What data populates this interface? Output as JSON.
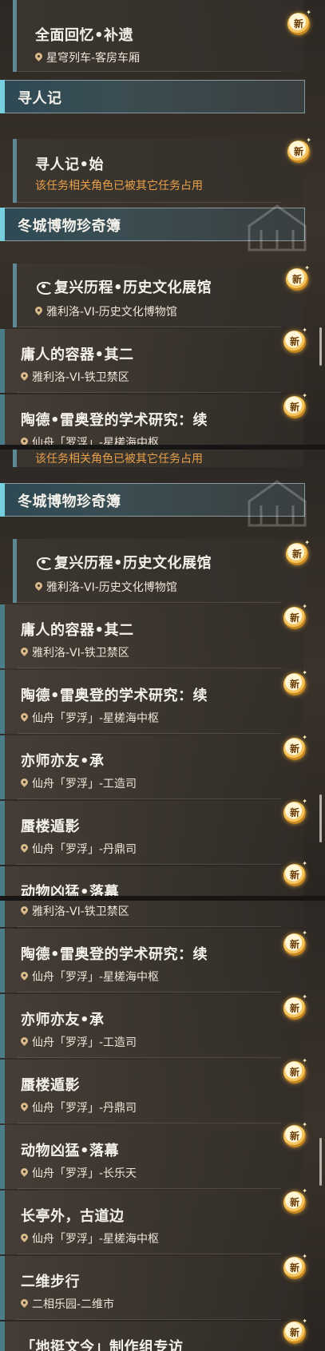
{
  "new_badge": "新",
  "colors": {
    "accent": "#4a7d88",
    "header_bar": "#77d0e0",
    "warn": "#e8a04a",
    "badge": "#f6c45c"
  },
  "panel1": {
    "r1": {
      "title": "全面回忆•补遗",
      "loc": "星穹列车-客房车厢"
    },
    "h1": {
      "title": "寻人记"
    },
    "r2": {
      "title": "寻人记•始",
      "loc": "该任务相关角色已被其它任务占用"
    },
    "h2": {
      "title": "冬城博物珍奇簿"
    },
    "r3": {
      "title": "复兴历程•历史文化展馆",
      "loc": "雅利洛-VI-历史文化博物馆"
    },
    "r4": {
      "title": "庸人的容器•其二",
      "loc": "雅利洛-VI-铁卫禁区"
    },
    "r5": {
      "title": "陶德•雷奥登的学术研究：续",
      "loc": "仙舟「罗浮」-星槎海中枢"
    }
  },
  "panel2": {
    "r0": {
      "loc": "该任务相关角色已被其它任务占用"
    },
    "h1": {
      "title": "冬城博物珍奇簿"
    },
    "r1": {
      "title": "复兴历程•历史文化展馆",
      "loc": "雅利洛-VI-历史文化博物馆"
    },
    "r2": {
      "title": "庸人的容器•其二",
      "loc": "雅利洛-VI-铁卫禁区"
    },
    "r3": {
      "title": "陶德•雷奥登的学术研究：续",
      "loc": "仙舟「罗浮」-星槎海中枢"
    },
    "r4": {
      "title": "亦师亦友•承",
      "loc": "仙舟「罗浮」-工造司"
    },
    "r5": {
      "title": "蜃楼遁影",
      "loc": "仙舟「罗浮」-丹鼎司"
    },
    "r6": {
      "title": "动物凶猛•落幕"
    }
  },
  "panel3": {
    "r0": {
      "loc": "雅利洛-VI-铁卫禁区"
    },
    "r1": {
      "title": "陶德•雷奥登的学术研究：续",
      "loc": "仙舟「罗浮」-星槎海中枢"
    },
    "r2": {
      "title": "亦师亦友•承",
      "loc": "仙舟「罗浮」-工造司"
    },
    "r3": {
      "title": "蜃楼遁影",
      "loc": "仙舟「罗浮」-丹鼎司"
    },
    "r4": {
      "title": "动物凶猛•落幕",
      "loc": "仙舟「罗浮」-长乐天"
    },
    "r5": {
      "title": "长亭外，古道边",
      "loc": "仙舟「罗浮」-星槎海中枢"
    },
    "r6": {
      "title": "二维步行",
      "loc": "二相乐园-二维市"
    },
    "r7": {
      "title": "「地挺文今」制作组专访"
    }
  }
}
